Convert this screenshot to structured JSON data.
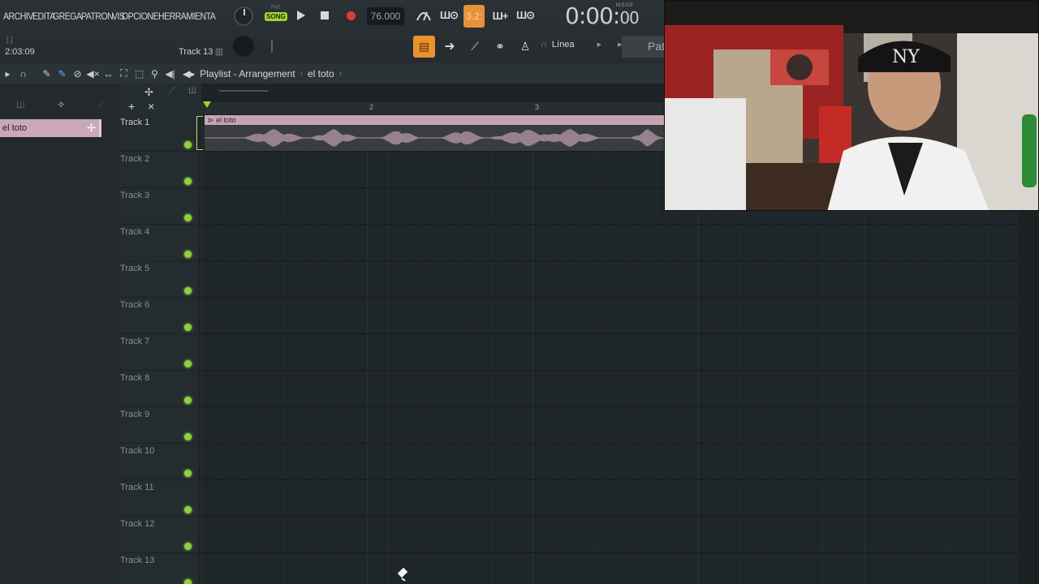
{
  "menu": [
    "ARCHIV",
    "EDITA",
    "GREGA",
    "PATRON",
    "VIS",
    "OPCIONE",
    "HERRAMIENTA"
  ],
  "transport": {
    "pat_label": "PAT",
    "song_label": "SONG",
    "tempo": "76.000",
    "step_label": "3.2:",
    "time_main": "0:00:",
    "time_sub": "00",
    "time_unit": "M:S:CS"
  },
  "hint": {
    "bracket": "[ ]",
    "time": "2:03:09",
    "track": "Track 13"
  },
  "snap": {
    "value": "Línea"
  },
  "pattern_button": "Patr",
  "playlist": {
    "title": "Playlist - Arrangement",
    "breadcrumb": "el toto",
    "ruler": [
      "2",
      "3"
    ]
  },
  "browser": {
    "clip_name": "el toto"
  },
  "clip": {
    "name": "el toto",
    "color": "#c5a4b2"
  },
  "tracks": [
    {
      "name": "Track 1"
    },
    {
      "name": "Track 2"
    },
    {
      "name": "Track 3"
    },
    {
      "name": "Track 4"
    },
    {
      "name": "Track 5"
    },
    {
      "name": "Track 6"
    },
    {
      "name": "Track 7"
    },
    {
      "name": "Track 8"
    },
    {
      "name": "Track 9"
    },
    {
      "name": "Track 10"
    },
    {
      "name": "Track 11"
    },
    {
      "name": "Track 12"
    },
    {
      "name": "Track 13"
    }
  ],
  "colors": {
    "accent_orange": "#e9932f",
    "led_green": "#8fd13b",
    "record_red": "#e23a3a"
  }
}
